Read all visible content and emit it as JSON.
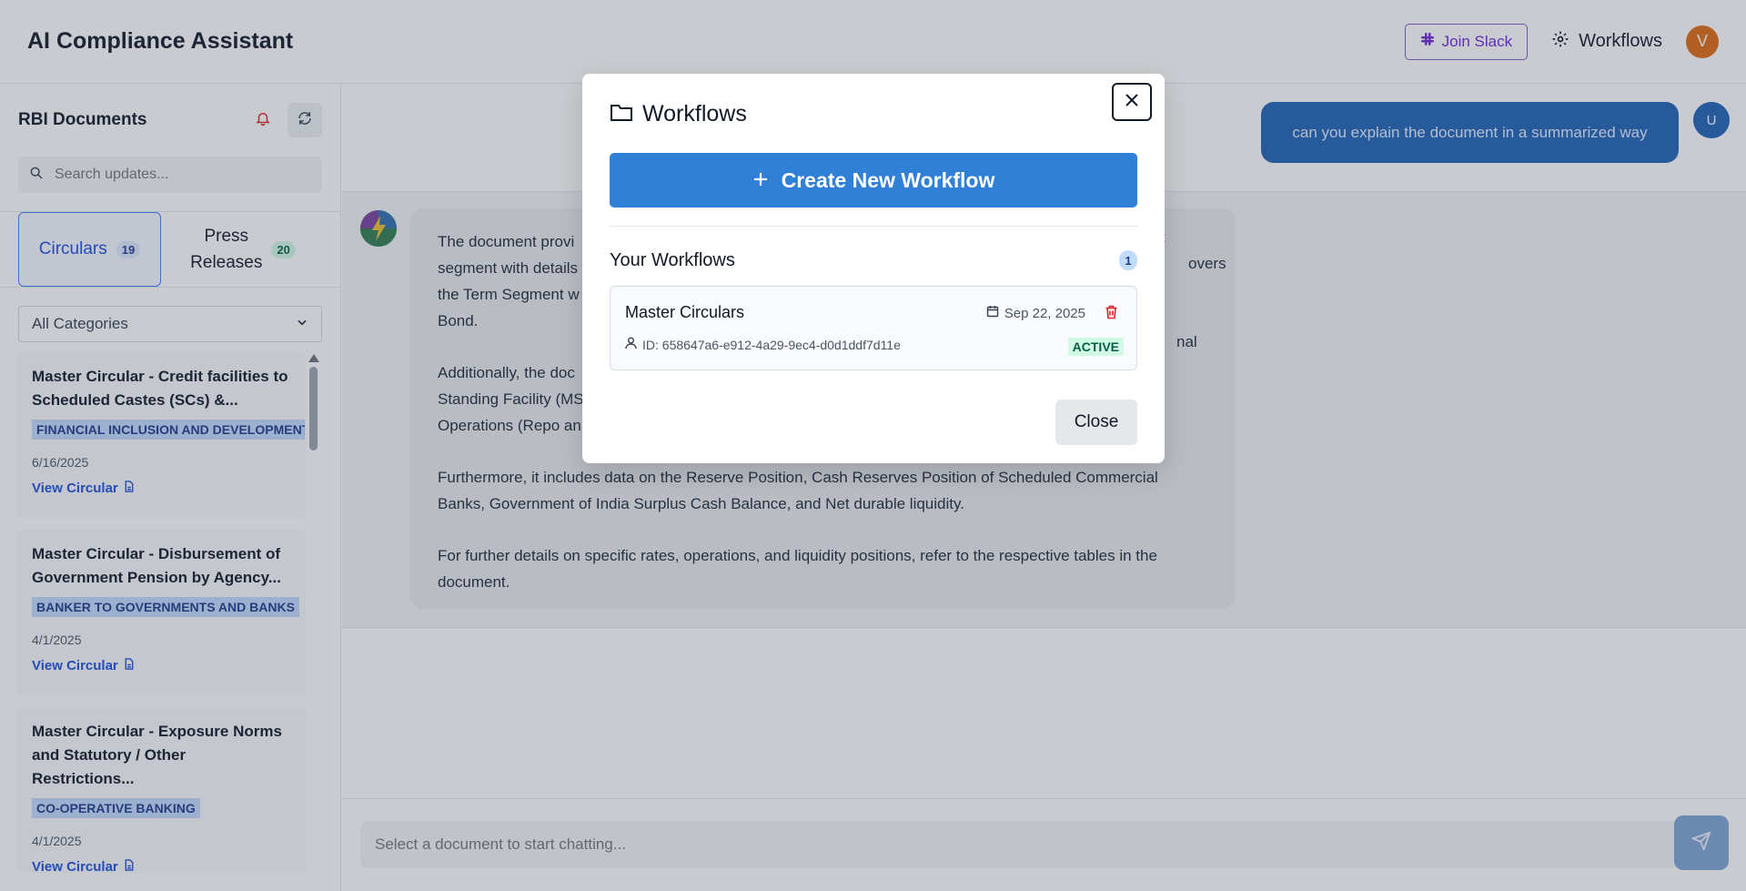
{
  "header": {
    "title": "AI Compliance Assistant",
    "slack_label": "Join Slack",
    "workflows_label": "Workflows",
    "avatar_initial": "V"
  },
  "sidebar": {
    "title": "RBI Documents",
    "search_placeholder": "Search updates...",
    "tabs": [
      {
        "label": "Circulars",
        "count": "19",
        "active": true
      },
      {
        "label_line1": "Press",
        "label_line2": "Releases",
        "count": "20",
        "active": false
      }
    ],
    "category_selected": "All Categories",
    "items": [
      {
        "title": "Master Circular - Credit facilities to Scheduled Castes (SCs) &...",
        "category": "FINANCIAL INCLUSION AND DEVELOPMENT",
        "date": "6/16/2025",
        "link": "View Circular"
      },
      {
        "title": "Master Circular - Disbursement of Government Pension by Agency...",
        "category": "BANKER TO GOVERNMENTS AND BANKS",
        "date": "4/1/2025",
        "link": "View Circular"
      },
      {
        "title": "Master Circular - Exposure Norms and Statutory / Other Restrictions...",
        "category": "CO-OPERATIVE BANKING",
        "date": "4/1/2025",
        "link": "View Circular"
      }
    ]
  },
  "chat": {
    "user_message": "can you explain the document in a summarized way",
    "user_initial": "U",
    "bot_paragraphs": [
      {
        "line1": "The document provi",
        "line2": "segment with details",
        "line3": "the Term Segment w",
        "line4": "Bond.",
        "tail1": "t",
        "tail2": "overs"
      },
      {
        "line1": "Additionally, the doc",
        "line2": "Standing Facility (MS",
        "line3": "Operations (Repo an",
        "tail1": "nal"
      },
      {
        "text": "Furthermore, it includes data on the Reserve Position, Cash Reserves Position of Scheduled Commercial Banks, Government of India Surplus Cash Balance, and Net durable liquidity."
      },
      {
        "text": "For further details on specific rates, operations, and liquidity positions, refer to the respective tables in the document."
      }
    ],
    "input_placeholder": "Select a document to start chatting..."
  },
  "modal": {
    "title": "Workflows",
    "create_label": "Create New Workflow",
    "section_title": "Your Workflows",
    "count": "1",
    "workflows": [
      {
        "name": "Master Circulars",
        "date": "Sep 22, 2025",
        "id": "ID: 658647a6-e912-4a29-9ec4-d0d1ddf7d11e",
        "status": "ACTIVE"
      }
    ],
    "close_label": "Close"
  },
  "colors": {
    "primary": "#2f80d6",
    "user_bubble": "#1f63b5",
    "active_tab": "#3b82f6",
    "slack_purple": "#6d28d9",
    "avatar_orange": "#e06a10",
    "status_green": "#065f46",
    "trash_red": "#dc2626"
  },
  "icons": [
    "slack-icon",
    "gear-icon",
    "bell-icon",
    "refresh-icon",
    "search-icon",
    "chevron-down-icon",
    "document-icon",
    "folder-icon",
    "close-icon",
    "plus-icon",
    "calendar-icon",
    "trash-icon",
    "user-icon",
    "send-icon"
  ]
}
